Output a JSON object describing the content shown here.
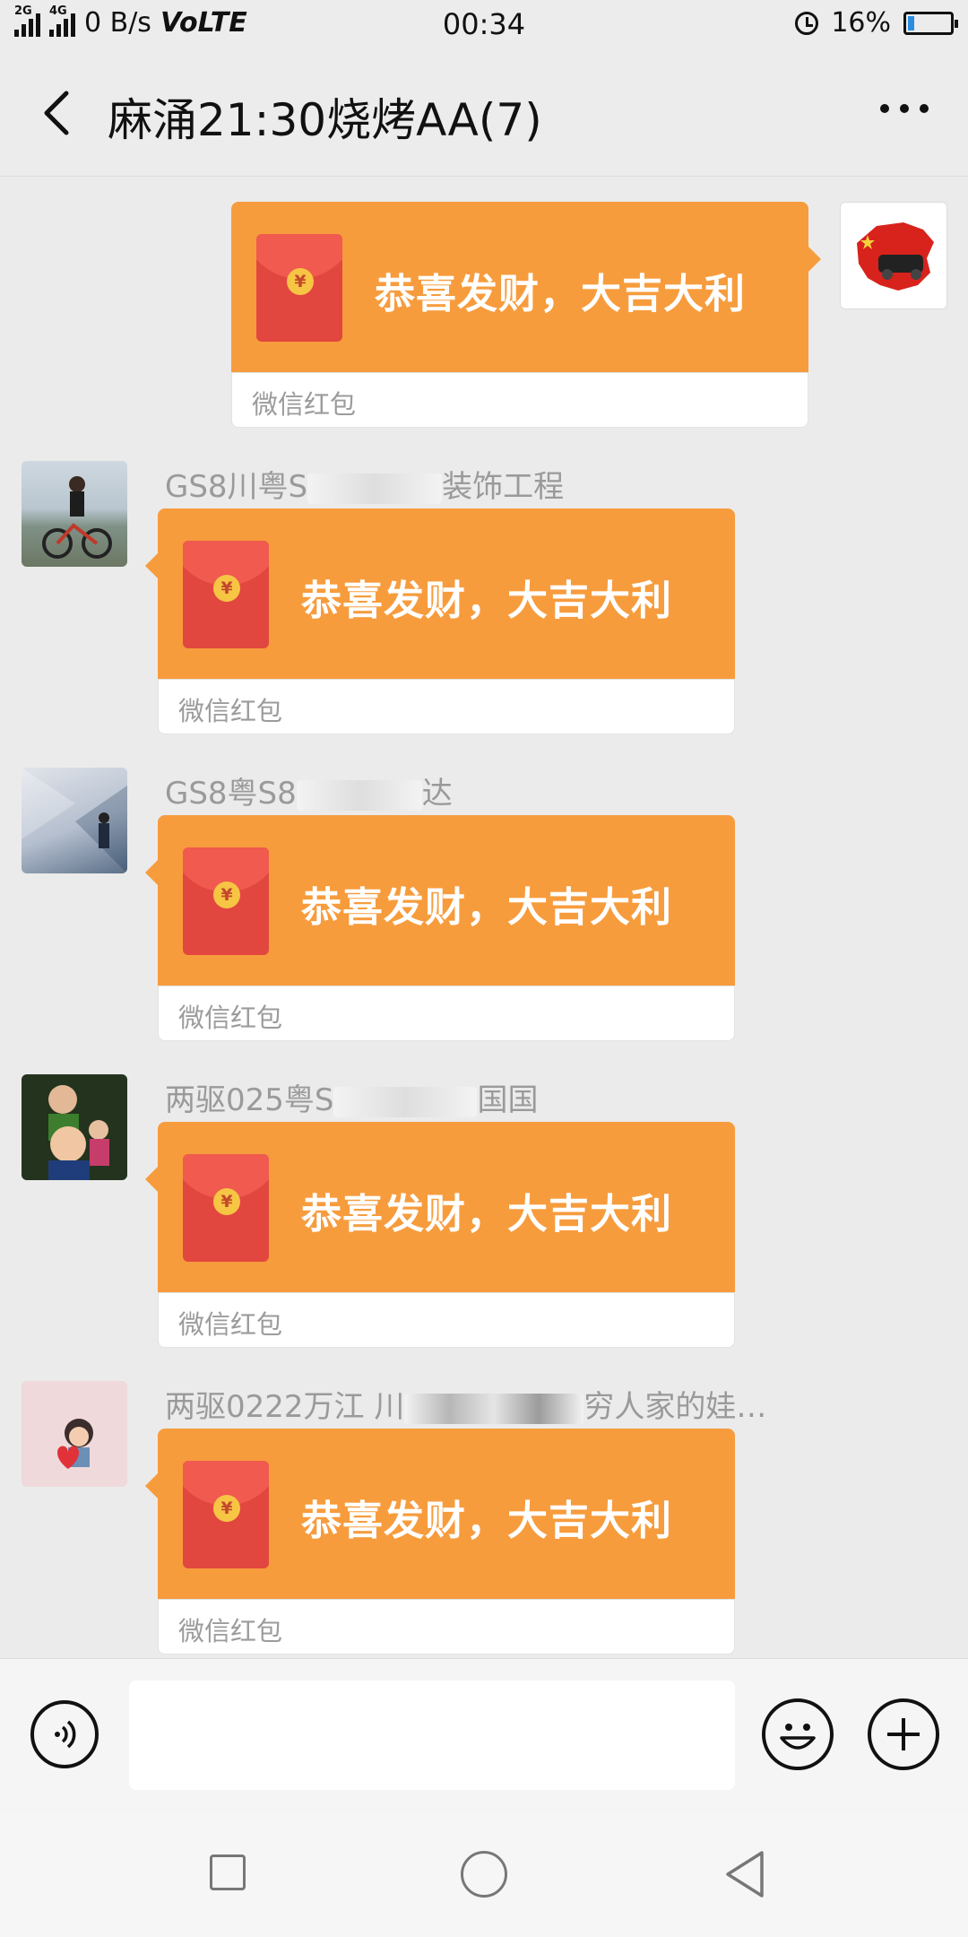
{
  "status_bar": {
    "net_2g": "2G",
    "net_4g": "4G",
    "speed": "0 B/s",
    "volte": "VoLTE",
    "time": "00:34",
    "battery": "16%",
    "battery_level": 0.16,
    "battery_color": "#2b8de0"
  },
  "header": {
    "title": "麻涌21:30烧烤AA(7)",
    "back_icon": "chevron-left-icon",
    "more_icon": "more-horizontal-icon"
  },
  "messages": [
    {
      "side": "right",
      "sender": "",
      "text": "恭喜发财，大吉大利",
      "caption": "微信红包"
    },
    {
      "side": "left",
      "sender_prefix": "GS8川粤S",
      "sender_suffix": "装饰工程",
      "text": "恭喜发财，大吉大利",
      "caption": "微信红包"
    },
    {
      "side": "left",
      "sender_prefix": "GS8粤S8",
      "sender_suffix": "达",
      "text": "恭喜发财，大吉大利",
      "caption": "微信红包"
    },
    {
      "side": "left",
      "sender_prefix": "两驱025粤S",
      "sender_suffix": "国国",
      "text": "恭喜发财，大吉大利",
      "caption": "微信红包"
    },
    {
      "side": "left",
      "sender_prefix": "两驱0222万江 川",
      "sender_suffix": "穷人家的娃…",
      "text": "恭喜发财，大吉大利",
      "caption": "微信红包"
    }
  ],
  "input_bar": {
    "voice_icon": "voice-icon",
    "text_value": "",
    "emoji_icon": "emoji-icon",
    "plus_icon": "plus-icon"
  },
  "nav_bar": {
    "recent_icon": "square-icon",
    "home_icon": "circle-icon",
    "back_icon": "triangle-back-icon"
  },
  "colors": {
    "packet_orange": "#f79c3d",
    "envelope_red": "#e2473f",
    "coin_gold": "#f6c544",
    "background": "#ebebeb"
  }
}
